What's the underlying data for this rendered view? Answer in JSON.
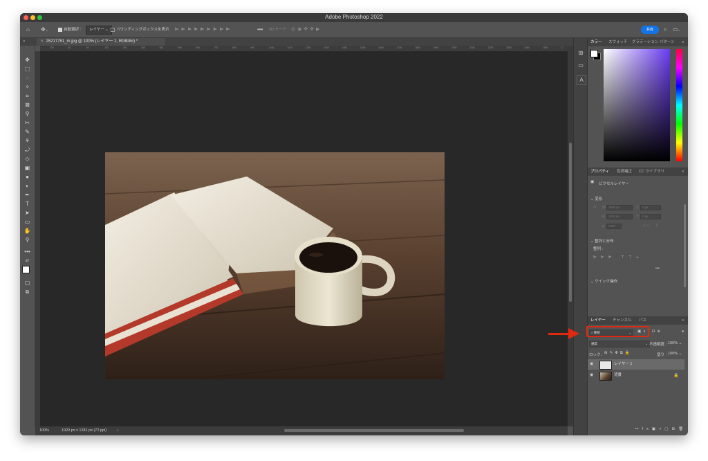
{
  "window": {
    "title": "Adobe Photoshop 2022"
  },
  "options_bar": {
    "auto_select_label": "自動選択 :",
    "layer_dropdown": "レイヤー",
    "bounding_box_label": "バウンディングボックスを表示",
    "mode_3d_label": "3D モード :",
    "share_label": "共有"
  },
  "document_tab": {
    "label": "25217751_m.jpg @ 100% (レイヤー 1, RGB/8#) *"
  },
  "ruler": {
    "ticks": [
      "150",
      "50",
      "50",
      "150",
      "250",
      "350",
      "450",
      "550",
      "650",
      "750",
      "850",
      "950",
      "1050",
      "1150",
      "1250",
      "1350",
      "1450",
      "1550",
      "1650",
      "1750",
      "1850",
      "1950",
      "2050",
      "2150",
      "2250",
      "2350",
      "2450",
      "2550",
      "27"
    ]
  },
  "status_bar": {
    "zoom": "100%",
    "doc_info": "1920 px x 1281 px (72 ppi)",
    "arrow": "›"
  },
  "color_panel": {
    "tabs": [
      "カラー",
      "スウォッチ",
      "グラデーション",
      "パターン"
    ]
  },
  "properties_panel": {
    "tabs": [
      "プロパティ",
      "色調補正",
      "CC ライブラリ"
    ],
    "layer_type": "ピクセルレイヤー",
    "transform_heading": "変形",
    "w_label": "W",
    "w_value": "1920 px",
    "x_label": "X",
    "x_value": "0 px",
    "h_label": "H",
    "h_value": "1281 px",
    "y_label": "Y",
    "y_value": "0 px",
    "angle_value": "0.00°",
    "align_heading": "整列と分布",
    "align_sub": "整列 :",
    "more": "•••",
    "quick_actions_heading": "クイック操作"
  },
  "layers_panel": {
    "tabs": [
      "レイヤー",
      "チャンネル",
      "パス"
    ],
    "search_kind": "種類",
    "blend_mode": "通常",
    "opacity_label": "不透明度 :",
    "opacity_value": "100%",
    "lock_label": "ロック :",
    "fill_label": "塗り :",
    "fill_value": "100%",
    "layers": [
      {
        "name": "レイヤー 1"
      },
      {
        "name": "背景"
      }
    ]
  },
  "colors": {
    "accent": "#1473e6",
    "annotation": "#e02a0f",
    "canvas_bg": "#282828",
    "panel_bg": "#535353"
  }
}
